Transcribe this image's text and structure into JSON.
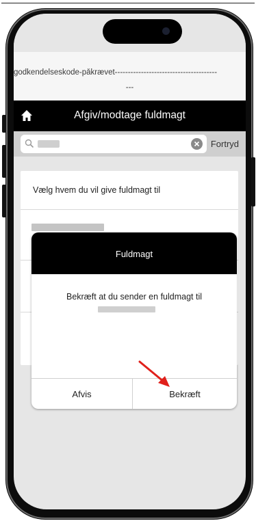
{
  "banner": {
    "line1": "godkendelseskode-påkrævet---------------------------------------",
    "line2": "---"
  },
  "header": {
    "title": "Afgiv/modtage fuldmagt",
    "home_icon": "home-icon"
  },
  "search": {
    "cancel_label": "Fortryd",
    "search_icon": "search-icon",
    "clear_icon": "clear-icon"
  },
  "list": {
    "items": [
      {
        "label": "Vælg hvem du vil give fuldmagt til"
      }
    ]
  },
  "modal": {
    "title": "Fuldmagt",
    "message": "Bekræft at du sender en fuldmagt til",
    "decline_label": "Afvis",
    "confirm_label": "Bekræft"
  },
  "colors": {
    "header_bg": "#000000",
    "annotation_arrow": "#e0201b",
    "screen_bg": "#e6e6e6"
  }
}
